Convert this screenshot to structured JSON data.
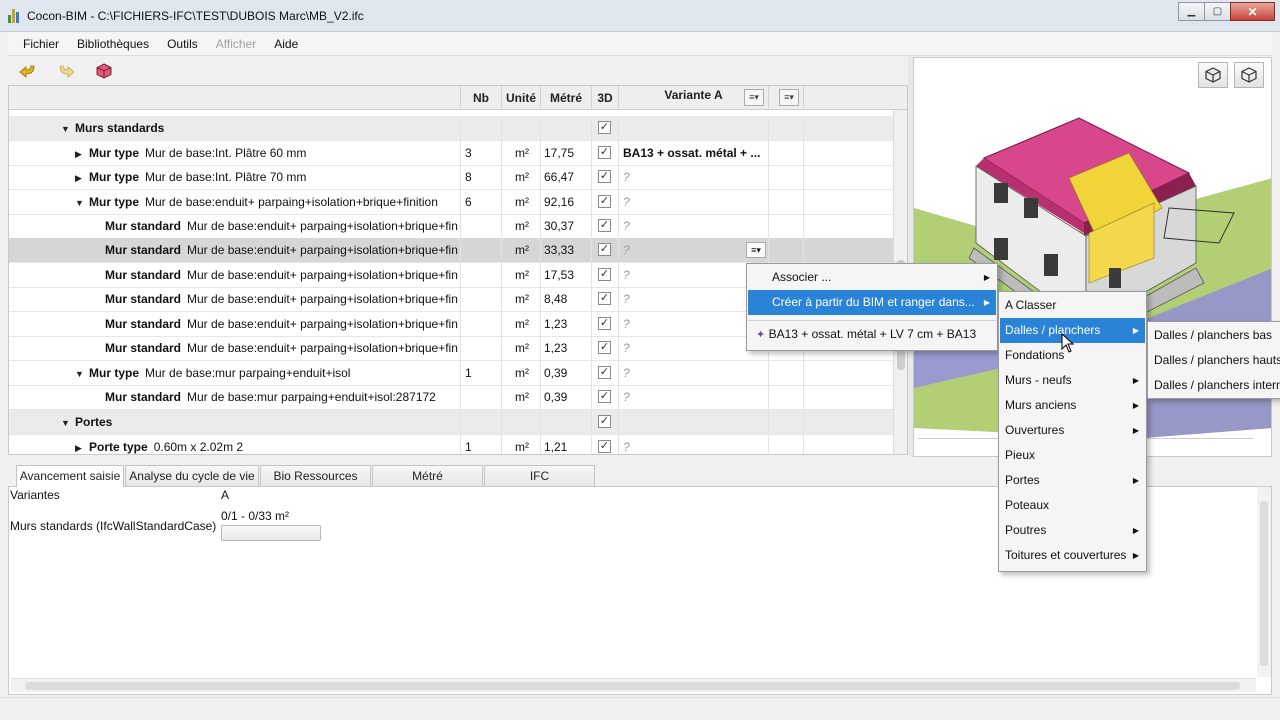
{
  "window": {
    "title": "Cocon-BIM  - C:\\FICHIERS-IFC\\TEST\\DUBOIS Marc\\MB_V2.ifc",
    "minimize_icon": "minimize-icon",
    "maximize_icon": "maximize-icon",
    "close_icon": "close-icon"
  },
  "menu": [
    "Fichier",
    "Bibliothèques",
    "Outils",
    "Afficher",
    "Aide"
  ],
  "toolbar": {
    "icons": [
      "undo-icon",
      "redo-icon",
      "cube-icon"
    ]
  },
  "grid": {
    "headers": {
      "nb": "Nb",
      "unit": "Unité",
      "metre": "Métré",
      "d3": "3D",
      "variant": "Variante A"
    },
    "rows": [
      {
        "kind": "Murs standards",
        "label": "",
        "nb": "",
        "unit": "",
        "metre": "",
        "variant": ""
      },
      {
        "kind": "Mur type",
        "label": "Mur de base:Int. Plâtre 60 mm",
        "nb": "3",
        "unit": "m²",
        "metre": "17,75",
        "variant": "BA13 + ossat. métal + ..."
      },
      {
        "kind": "Mur type",
        "label": "Mur de base:Int. Plâtre 70 mm",
        "nb": "8",
        "unit": "m²",
        "metre": "66,47",
        "variant": "?"
      },
      {
        "kind": "Mur type",
        "label": "Mur de base:enduit+ parpaing+isolation+brique+finition",
        "nb": "6",
        "unit": "m²",
        "metre": "92,16",
        "variant": "?"
      },
      {
        "kind": "Mur standard",
        "label": "Mur de base:enduit+ parpaing+isolation+brique+fin",
        "nb": "",
        "unit": "m²",
        "metre": "30,37",
        "variant": "?"
      },
      {
        "kind": "Mur standard",
        "label": "Mur de base:enduit+ parpaing+isolation+brique+fin",
        "nb": "",
        "unit": "m²",
        "metre": "33,33",
        "variant": "?"
      },
      {
        "kind": "Mur standard",
        "label": "Mur de base:enduit+ parpaing+isolation+brique+fin",
        "nb": "",
        "unit": "m²",
        "metre": "17,53",
        "variant": "?"
      },
      {
        "kind": "Mur standard",
        "label": "Mur de base:enduit+ parpaing+isolation+brique+fin",
        "nb": "",
        "unit": "m²",
        "metre": "8,48",
        "variant": "?"
      },
      {
        "kind": "Mur standard",
        "label": "Mur de base:enduit+ parpaing+isolation+brique+fin",
        "nb": "",
        "unit": "m²",
        "metre": "1,23",
        "variant": "?"
      },
      {
        "kind": "Mur standard",
        "label": "Mur de base:enduit+ parpaing+isolation+brique+fin",
        "nb": "",
        "unit": "m²",
        "metre": "1,23",
        "variant": "?"
      },
      {
        "kind": "Mur type",
        "label": "Mur de base:mur parpaing+enduit+isol",
        "nb": "1",
        "unit": "m²",
        "metre": "0,39",
        "variant": "?"
      },
      {
        "kind": "Mur standard",
        "label": "Mur de base:mur parpaing+enduit+isol:287172",
        "nb": "",
        "unit": "m²",
        "metre": "0,39",
        "variant": "?"
      },
      {
        "kind": "Portes",
        "label": "",
        "nb": "",
        "unit": "",
        "metre": "",
        "variant": ""
      },
      {
        "kind": "Porte type",
        "label": "0.60m x 2.02m 2",
        "nb": "1",
        "unit": "m²",
        "metre": "1,21",
        "variant": "?"
      }
    ]
  },
  "context_menu": {
    "items": [
      "Associer ...",
      "Créer à partir du BIM et ranger dans...",
      "BA13 + ossat. métal + LV 7 cm + BA13"
    ]
  },
  "submenu1": {
    "items": [
      "A Classer",
      "Dalles / planchers",
      "Fondations",
      "Murs - neufs",
      "Murs anciens",
      "Ouvertures",
      "Pieux",
      "Portes",
      "Poteaux",
      "Poutres",
      "Toitures et couvertures"
    ]
  },
  "submenu2": {
    "items": [
      "Dalles / planchers bas",
      "Dalles / planchers hauts",
      "Dalles / planchers intermédiaires"
    ]
  },
  "bottom_tabs": [
    "Avancement saisie",
    "Analyse du cycle de vie",
    "Bio Ressources",
    "Métré",
    "IFC"
  ],
  "bottom_panel": {
    "variantes_label": "Variantes",
    "variantes_value": "A",
    "murs_label": "Murs standards (IfcWallStandardCase)",
    "murs_value": "0/1 - 0/33 m²",
    "progress": 0
  },
  "view3d": {
    "icons": [
      "cube-solid-icon",
      "cube-wire-icon"
    ]
  },
  "colors": {
    "highlight": "#2a83d6",
    "roof": "#d6408c",
    "selection_yellow": "#f1d43a",
    "ground": "#a6c86a"
  }
}
